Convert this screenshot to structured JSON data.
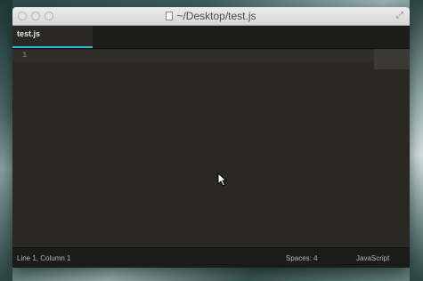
{
  "window": {
    "title": "~/Desktop/test.js"
  },
  "tabs": [
    {
      "label": "test.js",
      "active": true
    }
  ],
  "editor": {
    "line_numbers": [
      "1"
    ],
    "content": ""
  },
  "statusbar": {
    "position": "Line 1, Column 1",
    "indentation": "Spaces: 4",
    "syntax": "JavaScript"
  },
  "colors": {
    "editor_background": "#292824",
    "tab_accent": "#2fb6d6"
  }
}
